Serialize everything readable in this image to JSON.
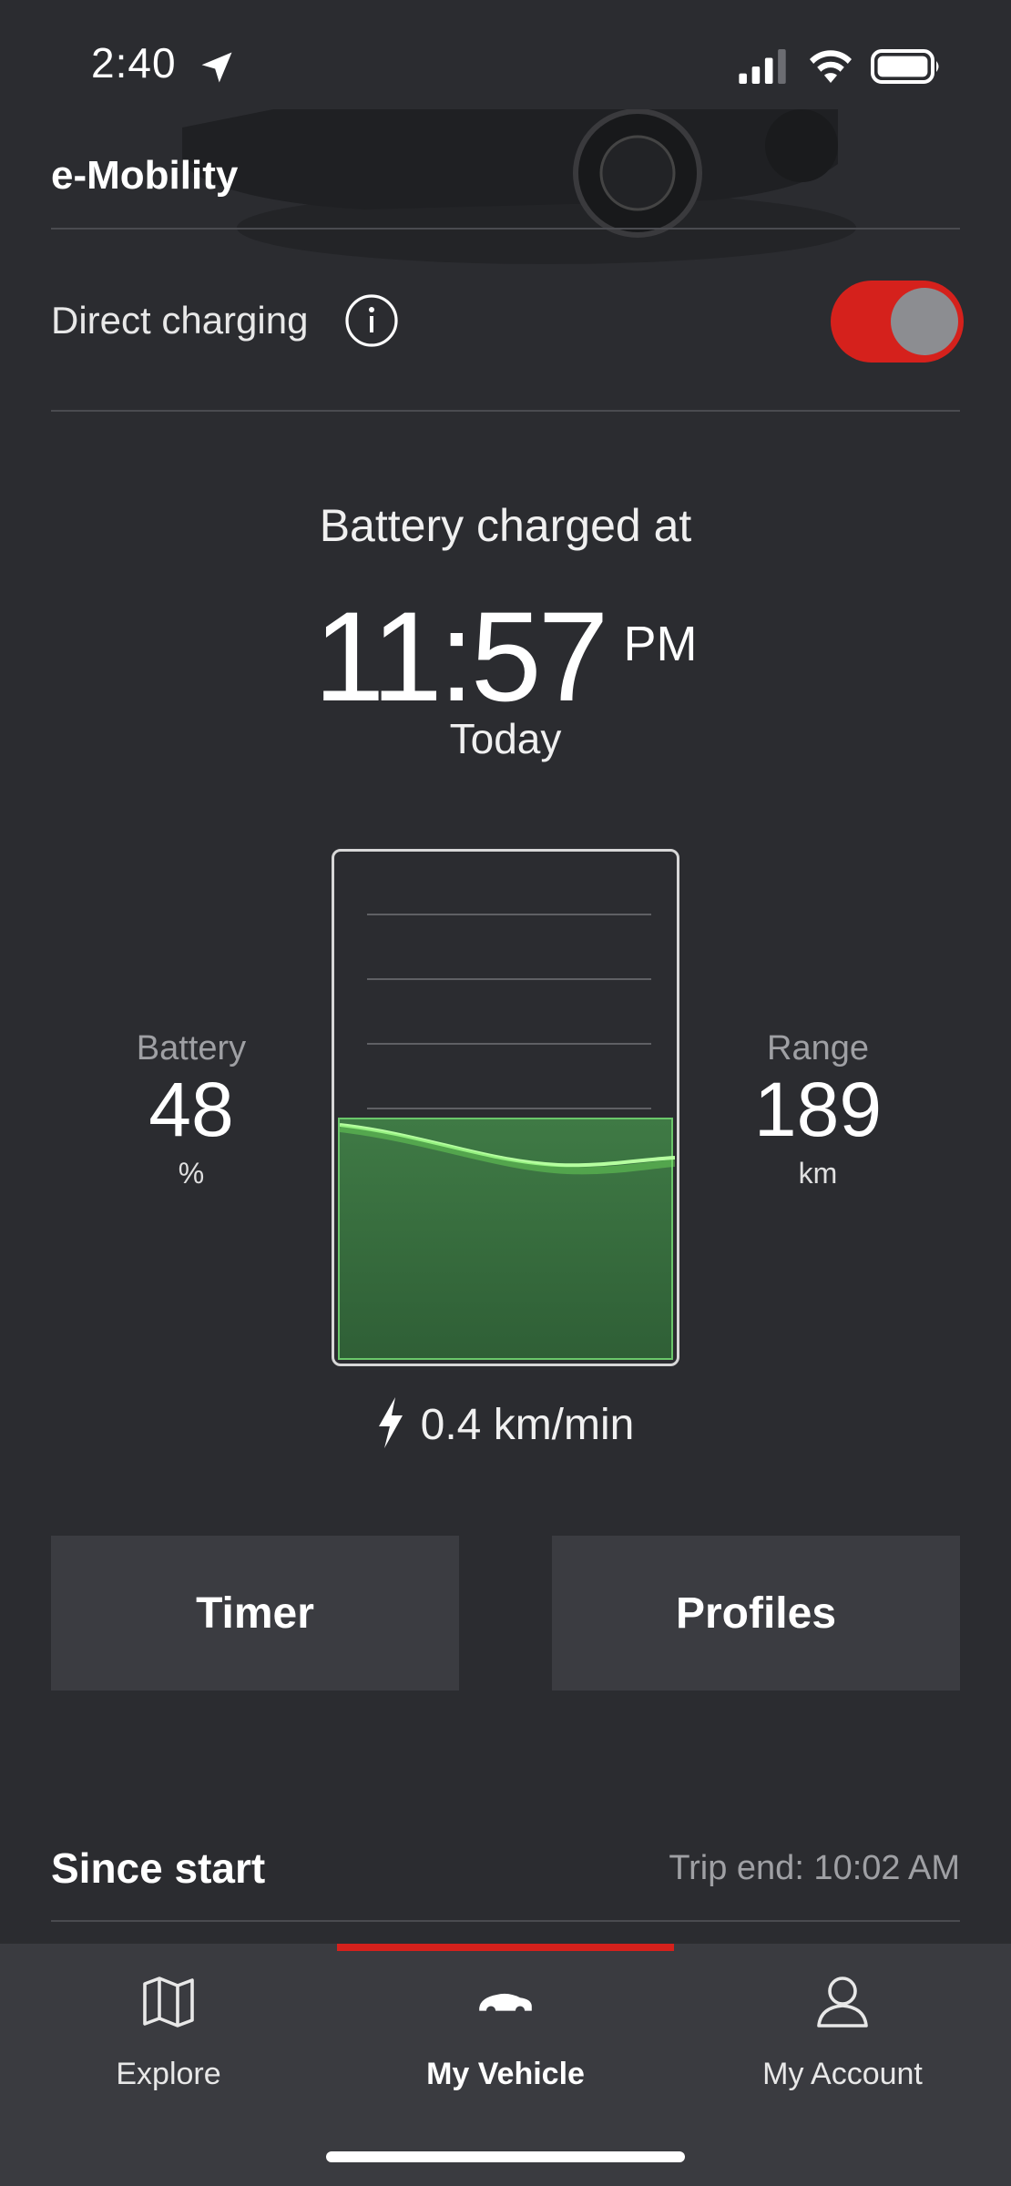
{
  "status_bar": {
    "time": "2:40"
  },
  "header": {
    "title": "e-Mobility"
  },
  "direct_charging": {
    "label": "Direct charging",
    "enabled": true,
    "toggle_color": "#d5211c"
  },
  "charge_status": {
    "label": "Battery charged at",
    "time": "11:57",
    "ampm": "PM",
    "day": "Today"
  },
  "battery": {
    "label": "Battery",
    "value": "48",
    "unit": "%",
    "level_fraction": 0.48,
    "fill_color": "#3f7a45"
  },
  "range": {
    "label": "Range",
    "value": "189",
    "unit": "km"
  },
  "charging_rate": "0.4 km/min",
  "buttons": {
    "timer": "Timer",
    "profiles": "Profiles"
  },
  "since_start": {
    "title": "Since start",
    "trip_end": "Trip end: 10:02 AM"
  },
  "tabbar": {
    "active_index": 1,
    "accent": "#d5211c",
    "tabs": [
      {
        "label": "Explore",
        "icon": "map-icon"
      },
      {
        "label": "My Vehicle",
        "icon": "car-icon"
      },
      {
        "label": "My Account",
        "icon": "account-icon"
      }
    ]
  }
}
